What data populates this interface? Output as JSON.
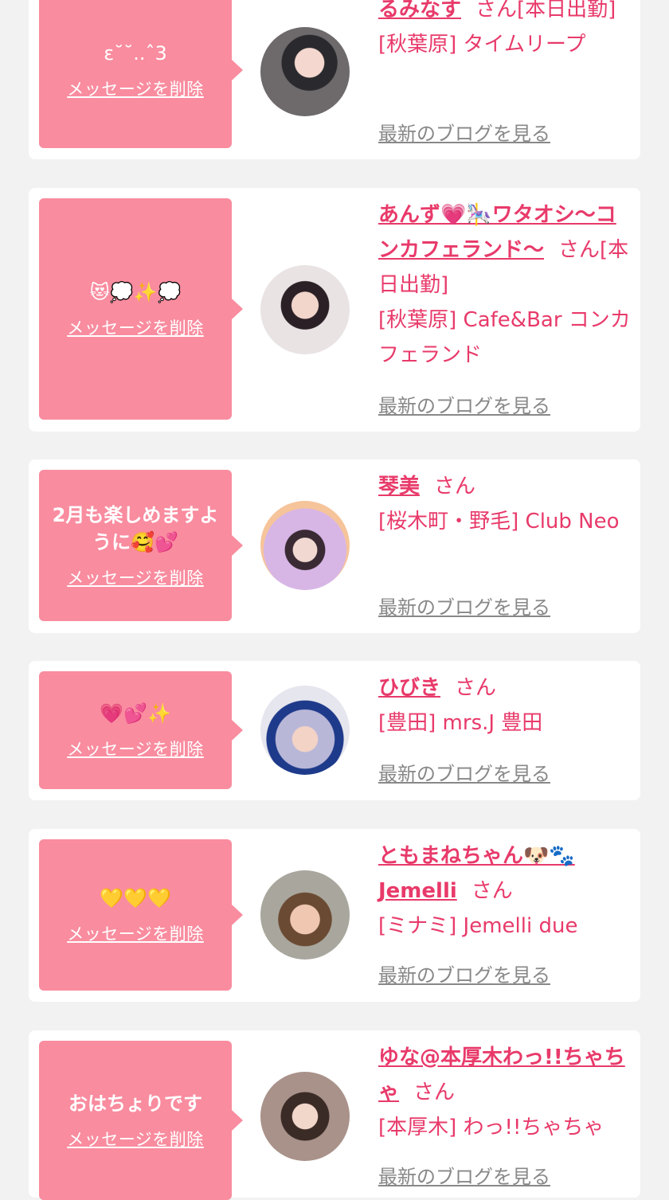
{
  "delete_label": "メッセージを削除",
  "blog_label": "最新のブログを見る",
  "cards": [
    {
      "message": "ε˘˘..ˆ3",
      "name": "るみなす",
      "suffix": "さん[本日出勤]",
      "shop": "[秋葉原] タイムリープ"
    },
    {
      "message": "😻💭✨💭",
      "name": "あんず💗🎠ワタオシ〜コンカフェランド〜",
      "suffix": "さん[本日出勤]",
      "shop": "[秋葉原] Cafe&Bar コンカフェランド"
    },
    {
      "message": "2月も楽しめますように🥰💕",
      "name": "琴美",
      "suffix": "さん",
      "shop": "[桜木町・野毛] Club Neo"
    },
    {
      "message": "💗💕✨",
      "name": "ひびき",
      "suffix": "さん",
      "shop": "[豊田] mrs.J 豊田"
    },
    {
      "message": "💛💛💛",
      "name": "ともまねちゃん🐶🐾Jemelli",
      "suffix": "さん",
      "shop": "[ミナミ] Jemelli due"
    },
    {
      "message": "おはちょりです",
      "name": "ゆな@本厚木わっ!!ちゃちゃ",
      "suffix": "さん",
      "shop": "[本厚木] わっ!!ちゃちゃ"
    }
  ],
  "colors": {
    "bubble": "#f98c9f",
    "accent": "#e83a6a",
    "background": "#f2f2f2"
  }
}
